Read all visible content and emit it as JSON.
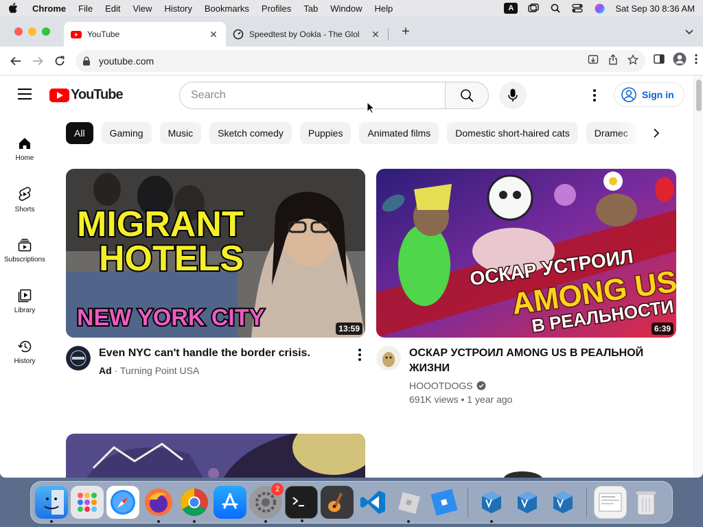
{
  "menubar": {
    "app": "Chrome",
    "items": [
      "File",
      "Edit",
      "View",
      "History",
      "Bookmarks",
      "Profiles",
      "Tab",
      "Window",
      "Help"
    ],
    "input_badge": "A",
    "datetime": "Sat Sep 30  8:36 AM"
  },
  "tabs": [
    {
      "title": "YouTube",
      "active": true
    },
    {
      "title": "Speedtest by Ookla - The Glol",
      "active": false
    }
  ],
  "address": {
    "url": "youtube.com"
  },
  "youtube": {
    "search_placeholder": "Search",
    "sign_in": "Sign in",
    "chips": [
      "All",
      "Gaming",
      "Music",
      "Sketch comedy",
      "Puppies",
      "Animated films",
      "Domestic short-haired cats",
      "Dramec"
    ],
    "guide": [
      {
        "label": "Home",
        "icon": "home-icon"
      },
      {
        "label": "Shorts",
        "icon": "shorts-icon"
      },
      {
        "label": "Subscriptions",
        "icon": "subscriptions-icon"
      },
      {
        "label": "Library",
        "icon": "library-icon"
      },
      {
        "label": "History",
        "icon": "history-icon"
      }
    ],
    "videos": [
      {
        "thumb_text_1": "MIGRANT",
        "thumb_text_2": "HOTELS",
        "thumb_text_3": "NEW YORK CITY",
        "duration": "13:59",
        "title": "Even NYC can't handle the border crisis.",
        "ad_label": "Ad",
        "channel": "Turning Point USA"
      },
      {
        "thumb_text_1": "ОСКАР УСТРОИЛ",
        "thumb_text_2": "AMONG US",
        "thumb_text_3": "В РЕАЛЬНОСТИ",
        "duration": "6:39",
        "title": "ОСКАР УСТРОИЛ AMONG US В РЕАЛЬНОЙ ЖИЗНИ",
        "channel": "HOOOTDOGS",
        "stats": "691K views • 1 year ago"
      }
    ]
  },
  "dock": {
    "settings_badge": "2"
  },
  "colors": {
    "yt_red": "#ff0000",
    "link_blue": "#065fd4",
    "chip_bg": "#f2f2f2"
  }
}
